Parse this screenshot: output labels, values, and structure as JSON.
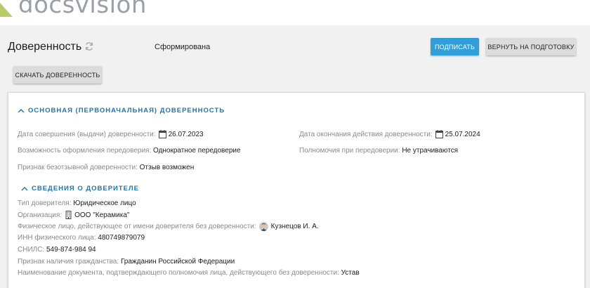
{
  "brand": {
    "logo_text": "docsvision"
  },
  "header": {
    "title": "Доверенность",
    "status": "Сформирована",
    "sign_label": "ПОДПИСАТЬ",
    "return_label": "ВЕРНУТЬ НА ПОДГОТОВКУ",
    "download_label": "СКАЧАТЬ ДОВЕРЕННОСТЬ"
  },
  "section_main": {
    "title": "ОСНОВНАЯ (ПЕРВОНАЧАЛЬНАЯ) ДОВЕРЕННОСТЬ",
    "issue_date": {
      "label": "Дата совершения (выдачи) доверенности:",
      "value": "26.07.2023"
    },
    "end_date": {
      "label": "Дата окончания действия доверенности:",
      "value": "25.07.2024"
    },
    "redelegation": {
      "label": "Возможность оформления передоверия:",
      "value": "Однократное передоверие"
    },
    "powers": {
      "label": "Полномочия при передоверии:",
      "value": "Не утрачиваются"
    },
    "irrevocable": {
      "label": "Признак безотзывной доверенности:",
      "value": "Отзыв возможен"
    }
  },
  "section_principal": {
    "title": "СВЕДЕНИЯ О ДОВЕРИТЕЛЕ",
    "type": {
      "label": "Тип доверителя:",
      "value": "Юридическое лицо"
    },
    "org": {
      "label": "Организация:",
      "value": "ООО \"Керамика\""
    },
    "person": {
      "label": "Физическое лицо, действующее от имени доверителя без доверенности:",
      "value": "Кузнецов И. А."
    },
    "inn": {
      "label": "ИНН физического лица:",
      "value": "480749879079"
    },
    "snils": {
      "label": "СНИЛС:",
      "value": "549-874-984 94"
    },
    "citizenship": {
      "label": "Признак наличия гражданства:",
      "value": "Гражданин Российской Федерации"
    },
    "doc": {
      "label": "Наименование документа, подтверждающего полномочия лица, действующего без доверенности:",
      "value": "Устав"
    }
  },
  "colors": {
    "accent": "#2f9ed9",
    "section_title": "#2474a3",
    "logo_mark": "#b7cd6b"
  },
  "icons": [
    "refresh-icon",
    "calendar-icon",
    "building-icon",
    "chevron-up-icon",
    "avatar"
  ]
}
